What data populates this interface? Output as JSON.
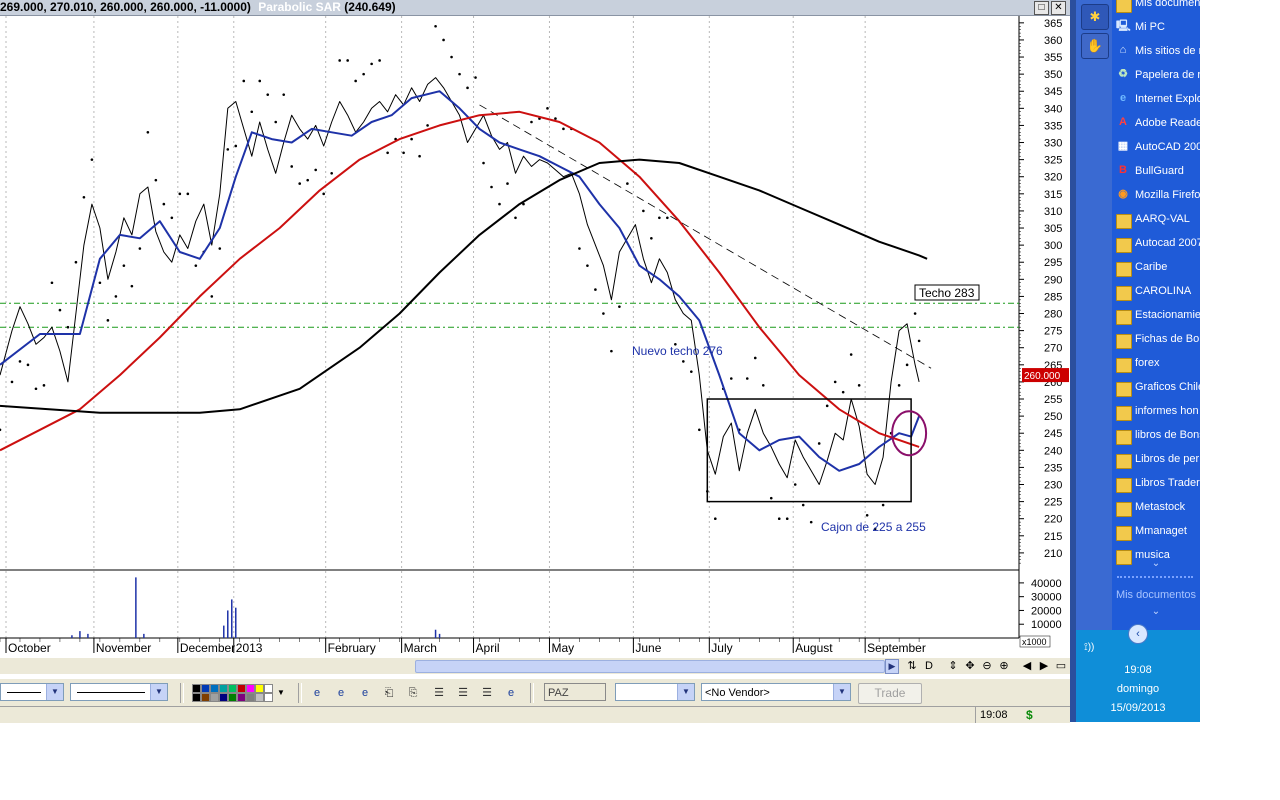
{
  "window": {
    "ohlc_readout": "269.000, 270.010, 260.000, 260.000, -11.0000)",
    "indicator_name": "Parabolic SAR",
    "indicator_value": "(240.649)",
    "restore_glyph": "□",
    "close_glyph": "✕"
  },
  "chart_data": {
    "type": "line",
    "title": "",
    "y_axis": {
      "range": [
        205,
        367
      ],
      "ticks": [
        365,
        360,
        355,
        350,
        345,
        340,
        335,
        330,
        325,
        320,
        315,
        310,
        305,
        300,
        295,
        290,
        285,
        280,
        275,
        270,
        265,
        260,
        255,
        250,
        245,
        240,
        235,
        230,
        225,
        220,
        215,
        210
      ]
    },
    "x_axis_months": [
      "October",
      "November",
      "December",
      "2013",
      "February",
      "March",
      "April",
      "May",
      "June",
      "July",
      "August",
      "September"
    ],
    "x_domain": [
      0,
      255
    ],
    "x_month_starts": [
      0,
      22,
      43,
      57,
      80,
      99,
      117,
      136,
      157,
      176,
      197,
      215
    ],
    "current_price_label": "260.000",
    "series": [
      {
        "role": "close",
        "color": "#000000",
        "values": [
          [
            0,
            262
          ],
          [
            3,
            275
          ],
          [
            5,
            282
          ],
          [
            7,
            277
          ],
          [
            9,
            271
          ],
          [
            11,
            273
          ],
          [
            13,
            276
          ],
          [
            15,
            269
          ],
          [
            17,
            260
          ],
          [
            19,
            280
          ],
          [
            21,
            300
          ],
          [
            23,
            312
          ],
          [
            25,
            305
          ],
          [
            27,
            290
          ],
          [
            29,
            298
          ],
          [
            31,
            308
          ],
          [
            33,
            303
          ],
          [
            35,
            315
          ],
          [
            37,
            317
          ],
          [
            39,
            304
          ],
          [
            41,
            298
          ],
          [
            43,
            295
          ],
          [
            45,
            303
          ],
          [
            47,
            299
          ],
          [
            49,
            307
          ],
          [
            51,
            312
          ],
          [
            53,
            300
          ],
          [
            55,
            315
          ],
          [
            57,
            340
          ],
          [
            59,
            342
          ],
          [
            61,
            334
          ],
          [
            63,
            326
          ],
          [
            65,
            336
          ],
          [
            67,
            328
          ],
          [
            69,
            321
          ],
          [
            71,
            330
          ],
          [
            73,
            338
          ],
          [
            75,
            334
          ],
          [
            77,
            331
          ],
          [
            79,
            335
          ],
          [
            81,
            329
          ],
          [
            83,
            336
          ],
          [
            85,
            342
          ],
          [
            87,
            338
          ],
          [
            89,
            333
          ],
          [
            91,
            336
          ],
          [
            93,
            340
          ],
          [
            95,
            342
          ],
          [
            97,
            339
          ],
          [
            99,
            344
          ],
          [
            101,
            341
          ],
          [
            103,
            346
          ],
          [
            105,
            342
          ],
          [
            107,
            347
          ],
          [
            109,
            349
          ],
          [
            111,
            346
          ],
          [
            113,
            342
          ],
          [
            115,
            338
          ],
          [
            117,
            330
          ],
          [
            119,
            334
          ],
          [
            121,
            338
          ],
          [
            123,
            332
          ],
          [
            125,
            328
          ],
          [
            127,
            330
          ],
          [
            129,
            321
          ],
          [
            131,
            326
          ],
          [
            133,
            323
          ],
          [
            135,
            325
          ],
          [
            137,
            324
          ],
          [
            139,
            322
          ],
          [
            141,
            320
          ],
          [
            143,
            321
          ],
          [
            145,
            315
          ],
          [
            147,
            306
          ],
          [
            149,
            300
          ],
          [
            151,
            294
          ],
          [
            153,
            284
          ],
          [
            155,
            298
          ],
          [
            157,
            302
          ],
          [
            159,
            306
          ],
          [
            161,
            296
          ],
          [
            163,
            289
          ],
          [
            165,
            296
          ],
          [
            167,
            292
          ],
          [
            169,
            284
          ],
          [
            171,
            280
          ],
          [
            173,
            278
          ],
          [
            175,
            262
          ],
          [
            177,
            240
          ],
          [
            179,
            233
          ],
          [
            181,
            244
          ],
          [
            183,
            248
          ],
          [
            185,
            234
          ],
          [
            187,
            245
          ],
          [
            189,
            252
          ],
          [
            191,
            245
          ],
          [
            193,
            241
          ],
          [
            195,
            236
          ],
          [
            197,
            232
          ],
          [
            199,
            243
          ],
          [
            201,
            238
          ],
          [
            203,
            234
          ],
          [
            205,
            230
          ],
          [
            207,
            237
          ],
          [
            209,
            245
          ],
          [
            211,
            243
          ],
          [
            213,
            255
          ],
          [
            215,
            247
          ],
          [
            217,
            233
          ],
          [
            219,
            230
          ],
          [
            221,
            238
          ],
          [
            223,
            260
          ],
          [
            225,
            275
          ],
          [
            227,
            277
          ],
          [
            229,
            265
          ],
          [
            230,
            260
          ]
        ]
      },
      {
        "role": "smooth_blue",
        "color": "#1e32a8",
        "values": [
          [
            0,
            265
          ],
          [
            10,
            274
          ],
          [
            20,
            274
          ],
          [
            25,
            296
          ],
          [
            30,
            303
          ],
          [
            35,
            302
          ],
          [
            40,
            307
          ],
          [
            45,
            298
          ],
          [
            50,
            296
          ],
          [
            55,
            305
          ],
          [
            59,
            320
          ],
          [
            63,
            333
          ],
          [
            68,
            331
          ],
          [
            73,
            330
          ],
          [
            78,
            334
          ],
          [
            83,
            333
          ],
          [
            88,
            332
          ],
          [
            93,
            336
          ],
          [
            98,
            338
          ],
          [
            103,
            343
          ],
          [
            110,
            345
          ],
          [
            115,
            340
          ],
          [
            120,
            334
          ],
          [
            125,
            330
          ],
          [
            130,
            328
          ],
          [
            135,
            326
          ],
          [
            140,
            323
          ],
          [
            145,
            320
          ],
          [
            150,
            312
          ],
          [
            155,
            305
          ],
          [
            160,
            294
          ],
          [
            165,
            290
          ],
          [
            170,
            285
          ],
          [
            175,
            278
          ],
          [
            180,
            262
          ],
          [
            185,
            245
          ],
          [
            190,
            240
          ],
          [
            195,
            243
          ],
          [
            200,
            244
          ],
          [
            205,
            238
          ],
          [
            210,
            234
          ],
          [
            215,
            236
          ],
          [
            220,
            241
          ],
          [
            225,
            245
          ],
          [
            228,
            244
          ],
          [
            230,
            250
          ]
        ]
      },
      {
        "role": "ma_red",
        "color": "#cc1010",
        "values": [
          [
            0,
            240
          ],
          [
            10,
            246
          ],
          [
            20,
            252
          ],
          [
            30,
            262
          ],
          [
            40,
            273
          ],
          [
            50,
            285
          ],
          [
            60,
            296
          ],
          [
            70,
            305
          ],
          [
            80,
            316
          ],
          [
            90,
            325
          ],
          [
            100,
            331
          ],
          [
            110,
            335
          ],
          [
            120,
            338
          ],
          [
            130,
            339
          ],
          [
            140,
            336
          ],
          [
            150,
            330
          ],
          [
            160,
            320
          ],
          [
            170,
            307
          ],
          [
            180,
            292
          ],
          [
            190,
            276
          ],
          [
            200,
            262
          ],
          [
            210,
            252
          ],
          [
            220,
            245
          ],
          [
            230,
            241
          ]
        ]
      },
      {
        "role": "ma_black",
        "color": "#000000",
        "values": [
          [
            0,
            253
          ],
          [
            25,
            251
          ],
          [
            50,
            251
          ],
          [
            60,
            252
          ],
          [
            75,
            258
          ],
          [
            90,
            270
          ],
          [
            100,
            280
          ],
          [
            110,
            292
          ],
          [
            120,
            303
          ],
          [
            130,
            312
          ],
          [
            140,
            319
          ],
          [
            150,
            324
          ],
          [
            160,
            325
          ],
          [
            170,
            324
          ],
          [
            180,
            320
          ],
          [
            190,
            316
          ],
          [
            200,
            311
          ],
          [
            210,
            306
          ],
          [
            220,
            301
          ],
          [
            230,
            297
          ],
          [
            232,
            296
          ]
        ]
      }
    ],
    "annotations": {
      "techo_283": {
        "label": "Techo 283",
        "value": 283
      },
      "nuevo_techo_276": {
        "label": "Nuevo techo 276",
        "value": 276
      },
      "cajon": {
        "label": "Cajon de 225 a 255",
        "low": 225,
        "high": 255
      }
    },
    "volume": {
      "ticks": [
        "40000",
        "30000",
        "20000",
        "10000"
      ],
      "multiplier_label": "x1000",
      "bars": [
        [
          18,
          2
        ],
        [
          20,
          5
        ],
        [
          22,
          3
        ],
        [
          34,
          44
        ],
        [
          36,
          3
        ],
        [
          56,
          9
        ],
        [
          57,
          20
        ],
        [
          58,
          28
        ],
        [
          59,
          22
        ],
        [
          109,
          6
        ],
        [
          110,
          3
        ]
      ]
    }
  },
  "navigator": {
    "icons": [
      "sync-icon",
      "d-icon",
      "updown-icon",
      "move-icon",
      "zoom-out-icon",
      "zoom-in-icon",
      "prev-icon",
      "next-icon",
      "fit-icon"
    ],
    "glyphs": [
      "⇅",
      "D",
      "⇕",
      "✥",
      "⊖",
      "⊕",
      "◀",
      "▶",
      "▭"
    ]
  },
  "toolbar": {
    "paz_value": "PAZ",
    "empty_combo_value": "",
    "vendor_value": "<No Vendor>",
    "trade_label": "Trade",
    "palette_colors": [
      "#000000",
      "#003ab5",
      "#0070c0",
      "#00a0a0",
      "#00c060",
      "#c00000",
      "#ff00ff",
      "#ffff00",
      "#ffffff",
      "#000000",
      "#7f3f00",
      "#a0a0a0",
      "#00007f",
      "#007f00",
      "#7f007f",
      "#7f7f7f",
      "#c0c0c0",
      "#ffffff"
    ]
  },
  "statusbar": {
    "clock": "19:08",
    "currency": "$"
  },
  "desktop": {
    "items": [
      {
        "label": "Mis documen",
        "icon": "folder-icon"
      },
      {
        "label": "Mi PC",
        "icon": "my-computer-icon"
      },
      {
        "label": "Mis sitios de r",
        "icon": "network-icon"
      },
      {
        "label": "Papelera de r",
        "icon": "recycle-bin-icon"
      },
      {
        "label": "Internet Explo",
        "icon": "internet-explorer-icon"
      },
      {
        "label": "Adobe Reade",
        "icon": "adobe-reader-icon"
      },
      {
        "label": "AutoCAD 200",
        "icon": "autocad-icon"
      },
      {
        "label": "BullGuard",
        "icon": "bullguard-icon"
      },
      {
        "label": "Mozilla Firefox",
        "icon": "firefox-icon"
      },
      {
        "label": "AARQ-VAL",
        "icon": "folder-icon"
      },
      {
        "label": "Autocad 2007",
        "icon": "folder-icon"
      },
      {
        "label": "Caribe",
        "icon": "folder-icon"
      },
      {
        "label": "CAROLINA",
        "icon": "folder-icon"
      },
      {
        "label": "Estacionamien",
        "icon": "folder-icon"
      },
      {
        "label": "Fichas de Bon",
        "icon": "folder-icon"
      },
      {
        "label": "forex",
        "icon": "folder-icon"
      },
      {
        "label": "Graficos Chile",
        "icon": "folder-icon"
      },
      {
        "label": "informes hon",
        "icon": "folder-icon"
      },
      {
        "label": "libros de Bons",
        "icon": "folder-icon"
      },
      {
        "label": "Libros de perr",
        "icon": "folder-icon"
      },
      {
        "label": "Libros Trader",
        "icon": "folder-icon"
      },
      {
        "label": "Metastock",
        "icon": "folder-icon"
      },
      {
        "label": "Mmanaget",
        "icon": "folder-icon"
      },
      {
        "label": "musica",
        "icon": "folder-icon"
      }
    ],
    "more_chevron": "⌄",
    "footer_label": "Mis documentos"
  },
  "tray": {
    "time": "19:08",
    "day": "domingo",
    "date": "15/09/2013"
  },
  "colors": {
    "desktop_bg": "#1f5bd8",
    "tray_bg": "#0f8ed8",
    "price_tag": "#cc0000"
  }
}
